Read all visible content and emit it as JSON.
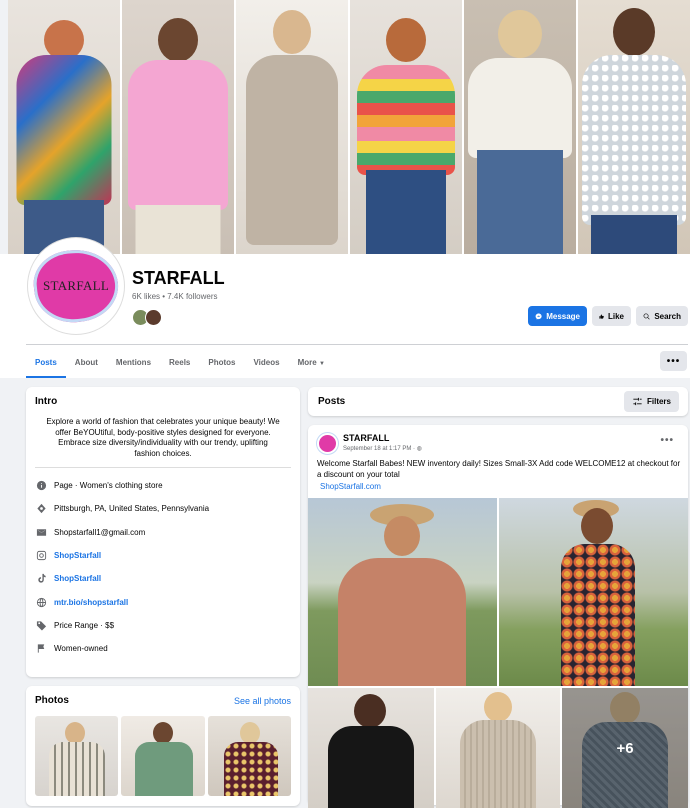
{
  "page": {
    "name": "STARFALL",
    "stats": "6K likes • 7.4K followers",
    "avatar_text": "STARFALL"
  },
  "actions": {
    "message": "Message",
    "like": "Like",
    "search": "Search"
  },
  "tabs": [
    "Posts",
    "About",
    "Mentions",
    "Reels",
    "Photos",
    "Videos",
    "More"
  ],
  "intro": {
    "title": "Intro",
    "bio": "Explore a world of fashion that celebrates your unique beauty! We offer BeYOUtiful, body-positive styles designed for everyone. Embrace size diversity/individuality with our trendy, uplifting fashion choices.",
    "items": [
      {
        "icon": "info-icon",
        "text": "Page · Women's clothing store",
        "link": false
      },
      {
        "icon": "location-pin-icon",
        "text": "Pittsburgh, PA, United States, Pennsylvania",
        "link": false
      },
      {
        "icon": "email-icon",
        "text": "Shopstarfall1@gmail.com",
        "link": false
      },
      {
        "icon": "instagram-icon",
        "text": "ShopStarfall",
        "link": true
      },
      {
        "icon": "tiktok-icon",
        "text": "ShopStarfall",
        "link": true
      },
      {
        "icon": "globe-icon",
        "text": "mtr.bio/shopstarfall",
        "link": true
      },
      {
        "icon": "price-tag-icon",
        "text": "Price Range · $$",
        "link": false
      },
      {
        "icon": "women-owned-icon",
        "text": "Women-owned",
        "link": false
      }
    ]
  },
  "photos": {
    "title": "Photos",
    "see_all": "See all photos"
  },
  "posts": {
    "title": "Posts",
    "filters": "Filters"
  },
  "post": {
    "author": "STARFALL",
    "time": "September 18 at 1:17 PM · ",
    "text": "Welcome Starfall Babes! NEW inventory daily! Sizes Small-3X Add code WELCOME12 at checkout for a discount on your total",
    "link": "ShopStarfall.com",
    "more_count": "+6"
  },
  "colors": {
    "accent": "#1b74e4",
    "brand_pink": "#e03aa7",
    "background": "#f0f2f5"
  }
}
